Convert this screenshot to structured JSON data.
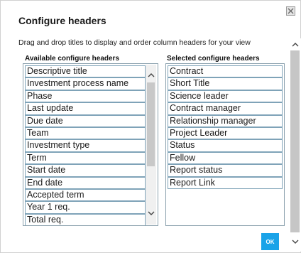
{
  "dialog": {
    "title": "Configure headers",
    "instructions": "Drag and drop titles to display and order column headers for your view",
    "close_icon": "close-icon",
    "ok_label": "OK",
    "accent_color": "#1aa3e8"
  },
  "available": {
    "header": "Available configure headers",
    "items": [
      "Descriptive title",
      "Investment process name",
      "Phase",
      "Last update",
      "Due date",
      "Team",
      "Investment type",
      "Term",
      "Start date",
      "End date",
      "Accepted term",
      "Year 1 req.",
      "Total req."
    ]
  },
  "selected": {
    "header": "Selected configure headers",
    "items": [
      "Contract",
      "Short Title",
      "Science leader",
      "Contract manager",
      "Relationship manager",
      "Project Leader",
      "Status",
      "Fellow",
      "Report status",
      "Report Link"
    ]
  }
}
